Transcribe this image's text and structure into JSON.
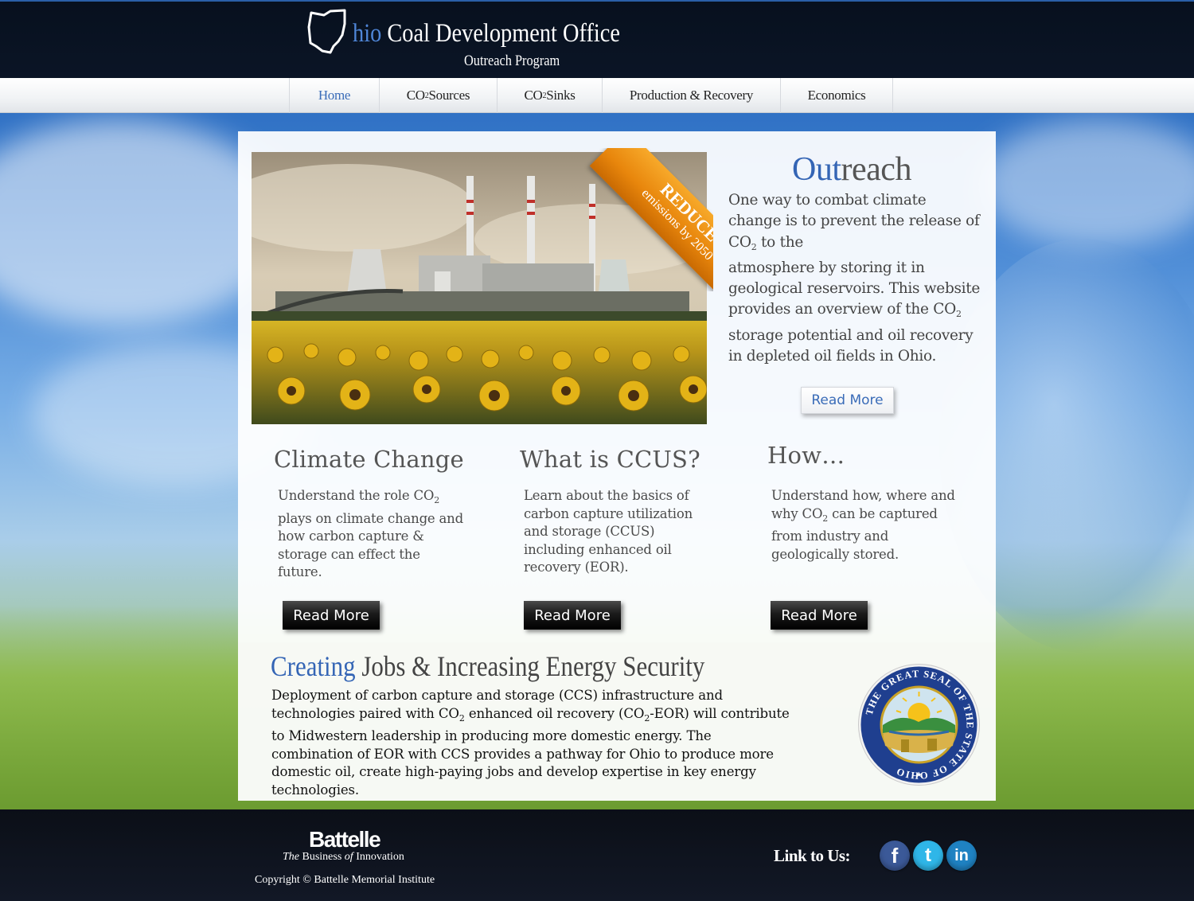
{
  "header": {
    "title_accent": "hio",
    "title_rest": " Coal Development Office",
    "subtitle": "Outreach Program"
  },
  "nav": {
    "items": [
      {
        "label": "Home",
        "active": true
      },
      {
        "label_pre": "CO",
        "label_sub": "2",
        "label_post": "Sources",
        "active": false
      },
      {
        "label_pre": "CO",
        "label_sub": "2",
        "label_post": "Sinks",
        "active": false
      },
      {
        "label": "Production & Recovery",
        "active": false
      },
      {
        "label": "Economics",
        "active": false
      }
    ]
  },
  "hero": {
    "ribbon_big": "REDUCE",
    "ribbon_small": "emissions by 2050",
    "outreach_title_accent": "Out",
    "outreach_title_rest": "reach",
    "text_1": "One way to combat climate change is to prevent the release of CO",
    "text_sub": "2",
    "text_2": " to the",
    "text_3": "atmosphere by storing it in geological reservoirs. This website provides an overview of the CO",
    "text_sub2": "2",
    "text_4": " storage potential and oil recovery in depleted oil fields in Ohio.",
    "read_more": "Read More"
  },
  "columns": [
    {
      "title": "Climate Change",
      "text_pre": "Understand the role CO",
      "text_sub": "2",
      "text_post": " plays on climate change and how carbon capture & storage can effect the future.",
      "button": "Read More"
    },
    {
      "title": "What is CCUS?",
      "text_pre": "Learn about the basics of carbon capture utilization and storage (CCUS) including enhanced oil recovery (EOR).",
      "text_sub": "",
      "text_post": "",
      "button": "Read More"
    },
    {
      "title": "How…",
      "text_pre": "Understand how, where and why CO",
      "text_sub": "2",
      "text_post": " can be captured from industry  and geologically stored.",
      "button": "Read More"
    }
  ],
  "jobs": {
    "title_accent": "Creating",
    "title_rest": " Jobs & Increasing Energy Security",
    "text_1": "Deployment of carbon capture and storage (CCS) infrastructure and technologies paired with CO",
    "sub_1": "2",
    "text_2": " enhanced oil recovery (CO",
    "sub_2": "2",
    "text_3": "-EOR) will contribute to Midwestern leadership in producing more domestic energy. The combination of EOR with CCS provides a pathway for Ohio to produce more domestic oil, create high-paying jobs and develop expertise in key energy technologies.",
    "seal_text": "THE GREAT SEAL OF THE STATE OF OHIO"
  },
  "footer": {
    "battelle": "Battelle",
    "tag_pre": "The",
    "tag_mid": " Business ",
    "tag_of": "of",
    "tag_post": " Innovation",
    "copyright": "Copyright © Battelle Memorial Institute",
    "link_us": "Link to Us:",
    "social": [
      {
        "name": "facebook",
        "glyph": "f",
        "color": "#3b5998"
      },
      {
        "name": "twitter",
        "glyph": "t",
        "color": "#2fb6e8"
      },
      {
        "name": "linkedin",
        "glyph": "in",
        "color": "#1f82c2"
      }
    ]
  },
  "colors": {
    "accent": "#3465b5",
    "header_bg": "#07101e",
    "ribbon": "#e8860c"
  }
}
